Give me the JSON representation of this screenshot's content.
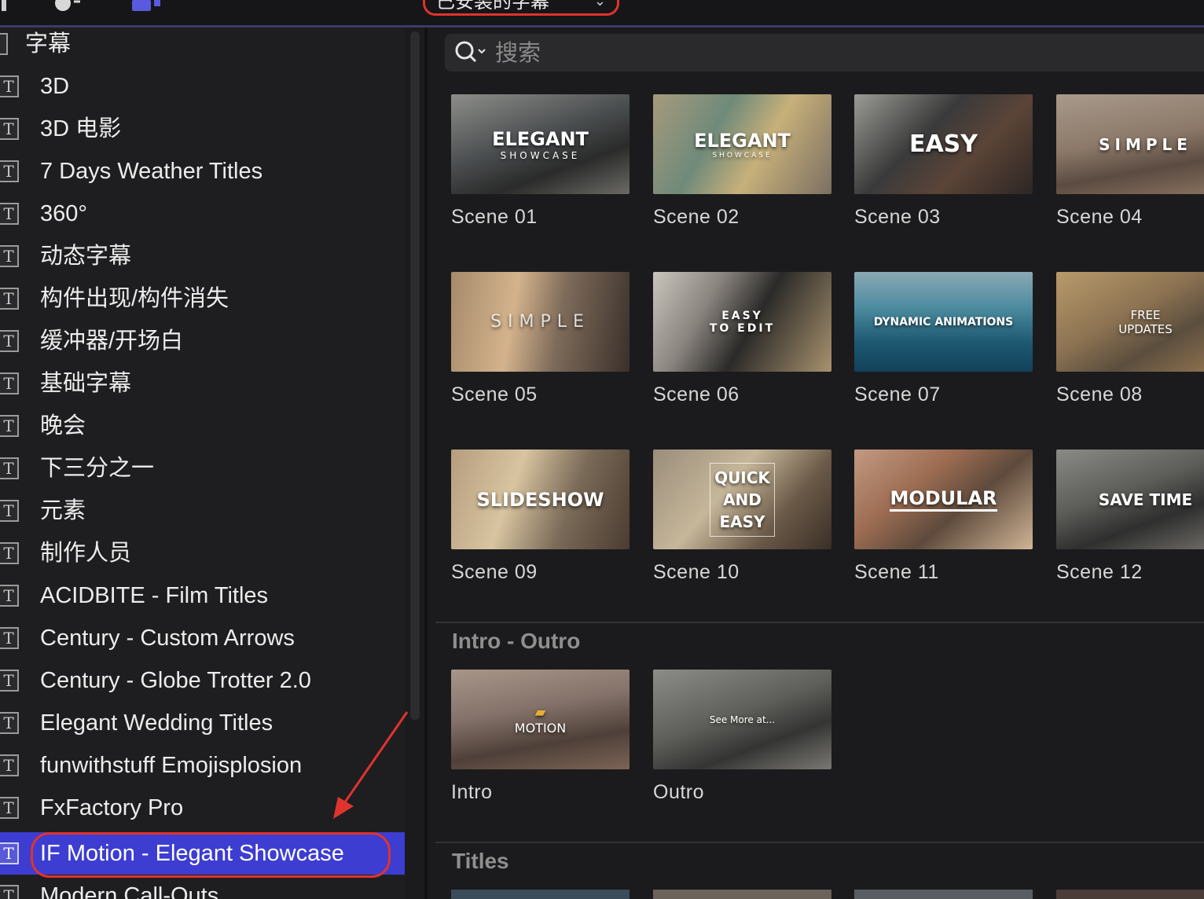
{
  "topbar": {
    "installed_label": "已安装的字幕",
    "chevron": "chevron-down-icon"
  },
  "search": {
    "placeholder": "搜索"
  },
  "sidebar": {
    "items": [
      {
        "label": "字幕"
      },
      {
        "label": "3D"
      },
      {
        "label": "3D 电影"
      },
      {
        "label": "7 Days Weather Titles"
      },
      {
        "label": "360°"
      },
      {
        "label": "动态字幕"
      },
      {
        "label": "构件出现/构件消失"
      },
      {
        "label": "缓冲器/开场白"
      },
      {
        "label": "基础字幕"
      },
      {
        "label": "晚会"
      },
      {
        "label": "下三分之一"
      },
      {
        "label": "元素"
      },
      {
        "label": "制作人员"
      },
      {
        "label": "ACIDBITE - Film Titles"
      },
      {
        "label": "Century - Custom Arrows"
      },
      {
        "label": "Century - Globe Trotter 2.0"
      },
      {
        "label": "Elegant Wedding Titles"
      },
      {
        "label": "funwithstuff Emojisplosion"
      },
      {
        "label": "FxFactory Pro"
      },
      {
        "label": "IF Motion - Elegant Showcase",
        "selected": true
      },
      {
        "label": "Modern Call-Outs"
      }
    ],
    "title_icon": "T"
  },
  "scenes": [
    {
      "name": "Scene 01",
      "overlay": "ELEGANT",
      "overlay_sub": "SHOWCASE"
    },
    {
      "name": "Scene 02",
      "overlay": "ELEGANT",
      "overlay_sub": "SHOWCASE"
    },
    {
      "name": "Scene 03",
      "overlay": "EASY",
      "overlay_sub": ""
    },
    {
      "name": "Scene 04",
      "overlay": "SIMPLE",
      "overlay_sub": ""
    },
    {
      "name": "Scene 05",
      "overlay": "SIMPLE",
      "overlay_sub": ""
    },
    {
      "name": "Scene 06",
      "overlay": "EASY TO EDIT",
      "overlay_sub": ""
    },
    {
      "name": "Scene 07",
      "overlay": "DYNAMIC ANIMATIONS",
      "overlay_sub": ""
    },
    {
      "name": "Scene 08",
      "overlay": "FREE UPDATES",
      "overlay_sub": ""
    },
    {
      "name": "Scene 09",
      "overlay": "SLIDESHOW",
      "overlay_sub": ""
    },
    {
      "name": "Scene 10",
      "overlay": "QUICK AND EASY",
      "overlay_sub": ""
    },
    {
      "name": "Scene 11",
      "overlay": "MODULAR",
      "overlay_sub": ""
    },
    {
      "name": "Scene 12",
      "overlay": "SAVE TIME",
      "overlay_sub": ""
    }
  ],
  "intro_outro": {
    "title": "Intro - Outro",
    "items": [
      {
        "name": "Intro",
        "overlay": "MOTION"
      },
      {
        "name": "Outro",
        "overlay": "See More at..."
      }
    ]
  },
  "titles_section": {
    "title": "Titles"
  }
}
